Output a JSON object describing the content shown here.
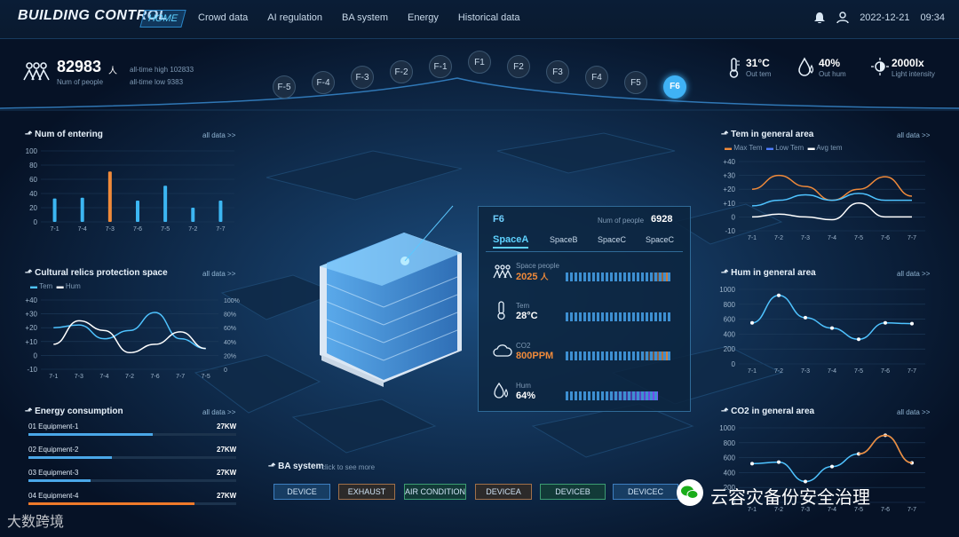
{
  "app": {
    "title": "BUILDING CONTROL"
  },
  "nav": [
    "HOME",
    "Crowd data",
    "AI regulation",
    "BA system",
    "Energy",
    "Historical data"
  ],
  "header": {
    "date": "2022-12-21",
    "time": "09:34"
  },
  "people": {
    "count": "82983",
    "unit": "人",
    "label": "Num of people",
    "high": "all-time high  102833",
    "low": "all-time low  9383"
  },
  "floors": [
    "F-5",
    "F-4",
    "F-3",
    "F-2",
    "F-1",
    "F1",
    "F2",
    "F3",
    "F4",
    "F5",
    "F6"
  ],
  "selected_floor": "F6",
  "weather": [
    {
      "value": "31°C",
      "label": "Out tem"
    },
    {
      "value": "40%",
      "label": "Out hum"
    },
    {
      "value": "2000lx",
      "label": "Light intensity"
    }
  ],
  "entering": {
    "title": "Num of entering",
    "link": "all data >>"
  },
  "relics": {
    "title": "Cultural relics protection space",
    "link": "all data >>",
    "legend": [
      "Tem",
      "Hum"
    ]
  },
  "energy": {
    "title": "Energy consumption",
    "link": "all data >>",
    "items": [
      {
        "label": "01 Equipment-1",
        "value": "27KW",
        "level": 0.6
      },
      {
        "label": "02 Equipment-2",
        "value": "27KW",
        "level": 0.4
      },
      {
        "label": "03 Equipment-3",
        "value": "27KW",
        "level": 0.3
      },
      {
        "label": "04 Equipment-4",
        "value": "27KW",
        "level": 0.8
      }
    ]
  },
  "temarea": {
    "title": "Tem in general area",
    "link": "all data >>",
    "legend": [
      "Max Tem",
      "Low Tem",
      "Avg tem"
    ]
  },
  "humarea": {
    "title": "Hum in general area",
    "link": "all data >>"
  },
  "co2area": {
    "title": "CO2 in general area",
    "link": "all data >>"
  },
  "ba": {
    "title": "BA system",
    "hint": "click to see more",
    "buttons": [
      "DEVICE",
      "EXHAUST",
      "AIR CONDITION",
      "DEVICEA",
      "DEVICEB",
      "DEVICEC"
    ]
  },
  "popup": {
    "floor": "F6",
    "people_label": "Num of people",
    "people_value": "6928",
    "spaces": [
      "SpaceA",
      "SpaceB",
      "SpaceC",
      "SpaceC"
    ],
    "metrics": [
      {
        "label": "Space people",
        "value": "2025",
        "unit": "人"
      },
      {
        "label": "Tem",
        "value": "28°C",
        "unit": ""
      },
      {
        "label": "CO2",
        "value": "800PPM",
        "unit": ""
      },
      {
        "label": "Hum",
        "value": "64%",
        "unit": ""
      }
    ]
  },
  "watermark": {
    "left": "大数跨境",
    "right": "云容灾备份安全治理"
  },
  "chart_data": [
    {
      "name": "entering",
      "type": "bar",
      "categories": [
        "7-1",
        "7-4",
        "7-3",
        "7-6",
        "7-5",
        "7-2",
        "7-7"
      ],
      "values": [
        33,
        34,
        71,
        30,
        51,
        20,
        30
      ],
      "ylim": [
        0,
        100
      ],
      "yticks": [
        0,
        20,
        40,
        60,
        80,
        100
      ],
      "highlight": 2
    },
    {
      "name": "relics",
      "type": "line",
      "categories": [
        "7-1",
        "7-3",
        "7-4",
        "7-2",
        "7-6",
        "7-7",
        "7-5"
      ],
      "series": [
        {
          "name": "Tem",
          "values": [
            20,
            22,
            12,
            18,
            31,
            12,
            5
          ]
        },
        {
          "name": "Hum",
          "values": [
            8,
            25,
            18,
            2,
            8,
            17,
            5
          ]
        }
      ],
      "ylim": [
        -10,
        40
      ],
      "yticks": [
        -10,
        0,
        10,
        20,
        30,
        40
      ],
      "y2ticks": [
        "0",
        "20%",
        "40%",
        "60%",
        "80%",
        "100%"
      ]
    },
    {
      "name": "temarea",
      "type": "line",
      "categories": [
        "7-1",
        "7-2",
        "7-3",
        "7-4",
        "7-5",
        "7-6",
        "7-7"
      ],
      "series": [
        {
          "name": "Max Tem",
          "values": [
            20,
            30,
            22,
            12,
            20,
            29,
            15
          ]
        },
        {
          "name": "Low Tem",
          "values": [
            8,
            12,
            16,
            12,
            17,
            12,
            12
          ]
        },
        {
          "name": "Avg tem",
          "values": [
            0,
            2,
            0,
            -2,
            10,
            0,
            0
          ]
        }
      ],
      "ylim": [
        -10,
        40
      ],
      "yticks": [
        -10,
        0,
        10,
        20,
        30,
        40
      ]
    },
    {
      "name": "humarea",
      "type": "line",
      "categories": [
        "7-1",
        "7-2",
        "7-3",
        "7-4",
        "7-5",
        "7-6",
        "7-7"
      ],
      "series": [
        {
          "name": "Hum",
          "values": [
            550,
            920,
            620,
            480,
            330,
            550,
            540
          ]
        }
      ],
      "ylim": [
        0,
        1000
      ],
      "yticks": [
        0,
        200,
        400,
        600,
        800,
        1000
      ]
    },
    {
      "name": "co2area",
      "type": "line",
      "categories": [
        "7-1",
        "7-2",
        "7-3",
        "7-4",
        "7-5",
        "7-6",
        "7-7"
      ],
      "series": [
        {
          "name": "CO2",
          "values": [
            520,
            540,
            280,
            480,
            650,
            900,
            530
          ]
        }
      ],
      "ylim": [
        0,
        1000
      ],
      "yticks": [
        0,
        200,
        400,
        600,
        800,
        1000
      ]
    }
  ]
}
